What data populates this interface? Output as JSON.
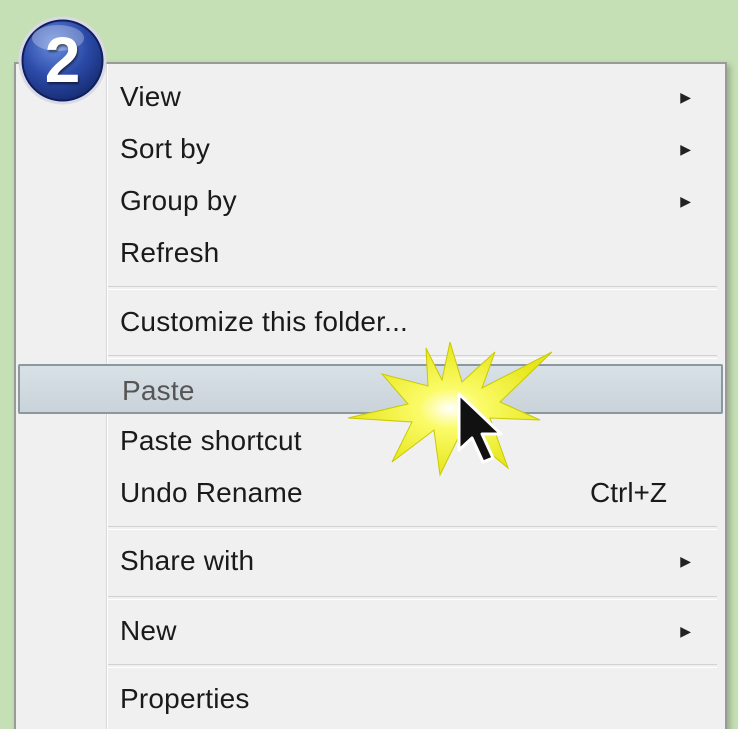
{
  "badge": {
    "number": "2",
    "icon": "step-number-badge"
  },
  "menu": {
    "items": [
      {
        "label": "View",
        "has_submenu": true
      },
      {
        "label": "Sort by",
        "has_submenu": true
      },
      {
        "label": "Group by",
        "has_submenu": true
      },
      {
        "label": "Refresh",
        "has_submenu": false
      },
      {
        "label": "Customize this folder...",
        "has_submenu": false
      },
      {
        "label": "Paste",
        "has_submenu": false,
        "highlighted": true
      },
      {
        "label": "Paste shortcut",
        "has_submenu": false
      },
      {
        "label": "Undo Rename",
        "shortcut": "Ctrl+Z"
      },
      {
        "label": "Share with",
        "has_submenu": true
      },
      {
        "label": "New",
        "has_submenu": true
      },
      {
        "label": "Properties",
        "has_submenu": false
      }
    ],
    "submenu_arrow": "▶"
  },
  "decoration": {
    "highlight_burst": "yellow-starburst-icon",
    "pointer": "mouse-pointer-icon"
  },
  "colors": {
    "background": "#c6e0b5",
    "menu_bg": "#f0f0f0",
    "highlight_bg": "#d0dadf",
    "badge_blue": "#2a47a6",
    "burst_yellow": "#f3f320"
  }
}
